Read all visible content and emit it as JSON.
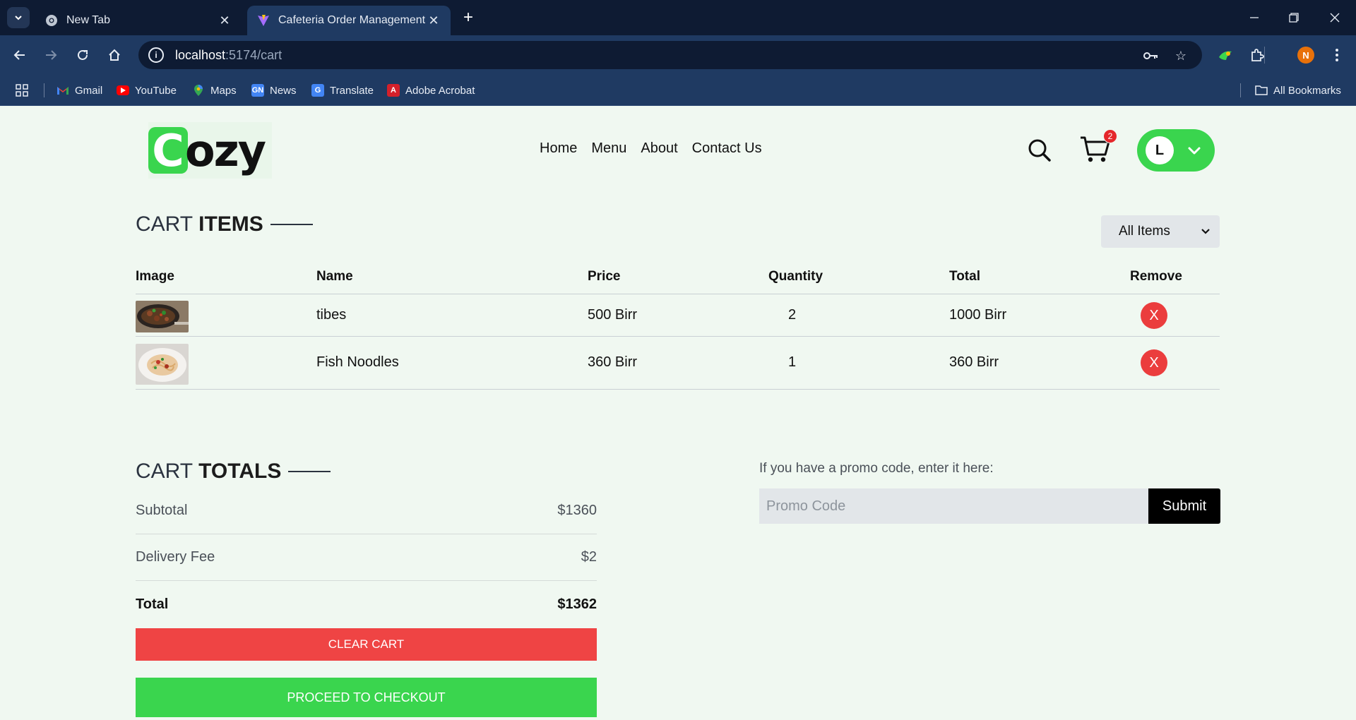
{
  "browser": {
    "tabs": [
      {
        "title": "New Tab",
        "active": false,
        "icon": "chrome-icon"
      },
      {
        "title": "Cafeteria Order Management",
        "active": true,
        "icon": "vite-icon"
      }
    ],
    "url_host": "localhost",
    "url_path": ":5174/cart",
    "profile_initial": "N",
    "bookmarks": [
      {
        "label": "Gmail",
        "icon": "gmail-icon",
        "color": "#ea4335"
      },
      {
        "label": "YouTube",
        "icon": "youtube-icon",
        "color": "#ff0000"
      },
      {
        "label": "Maps",
        "icon": "maps-icon",
        "color": "#34a853"
      },
      {
        "label": "News",
        "icon": "news-icon",
        "color": "#4285f4"
      },
      {
        "label": "Translate",
        "icon": "translate-icon",
        "color": "#4285f4"
      },
      {
        "label": "Adobe Acrobat",
        "icon": "acrobat-icon",
        "color": "#d4202a"
      }
    ],
    "all_bookmarks": "All Bookmarks"
  },
  "site": {
    "logo_initial": "C",
    "logo_rest": "ozy",
    "nav": [
      "Home",
      "Menu",
      "About",
      "Contact Us"
    ],
    "cart_count": "2",
    "user_initial": "L",
    "accent_color": "#3ad54e"
  },
  "cart": {
    "title_light": "CART",
    "title_bold": "ITEMS",
    "filter": "All Items",
    "headers": [
      "Image",
      "Name",
      "Price",
      "Quantity",
      "Total",
      "Remove"
    ],
    "items": [
      {
        "name": "tibes",
        "price": "500 Birr",
        "quantity": "2",
        "total": "1000 Birr",
        "remove": "X",
        "image": "tibs-dish"
      },
      {
        "name": "Fish Noodles",
        "price": "360 Birr",
        "quantity": "1",
        "total": "360 Birr",
        "remove": "X",
        "image": "noodles-dish"
      }
    ]
  },
  "totals": {
    "title_light": "CART",
    "title_bold": "TOTALS",
    "subtotal_label": "Subtotal",
    "subtotal_value": "$1360",
    "delivery_label": "Delivery Fee",
    "delivery_value": "$2",
    "total_label": "Total",
    "total_value": "$1362",
    "clear_label": "CLEAR CART",
    "checkout_label": "PROCEED TO CHECKOUT",
    "clear_color": "#ef4444"
  },
  "promo": {
    "label": "If you have a promo code, enter it here:",
    "placeholder": "Promo Code",
    "submit": "Submit"
  }
}
